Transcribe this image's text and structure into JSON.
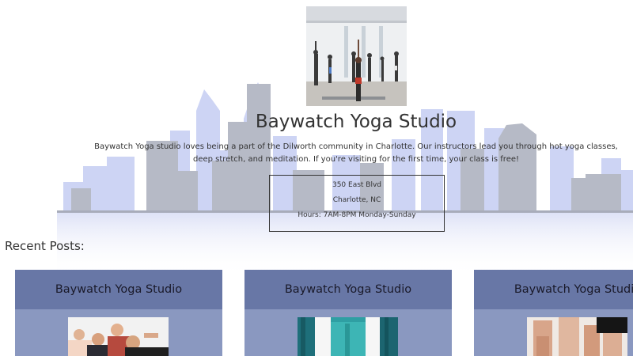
{
  "studio": {
    "name": "Baywatch Yoga Studio",
    "description": "Baywatch Yoga studio loves being a part of the Dilworth community in Charlotte. Our instructors lead you through hot yoga classes, deep stretch, and meditation. If you're visiting for the first time, your class is free!",
    "address_line1": "350 East Blvd",
    "address_line2": "Charlotte, NC",
    "hours": "Hours: 7AM-8PM Monday-Sunday"
  },
  "recent_posts": {
    "heading": "Recent Posts:",
    "posts": [
      {
        "title": "Baywatch Yoga Studio"
      },
      {
        "title": "Baywatch Yoga Studio"
      },
      {
        "title": "Baywatch Yoga Studio"
      }
    ]
  },
  "colors": {
    "card_header": "#6877a6",
    "card_body": "#8a98c0",
    "skyline_blue": "#c8d0f2",
    "skyline_gray": "#b4b8c4"
  }
}
